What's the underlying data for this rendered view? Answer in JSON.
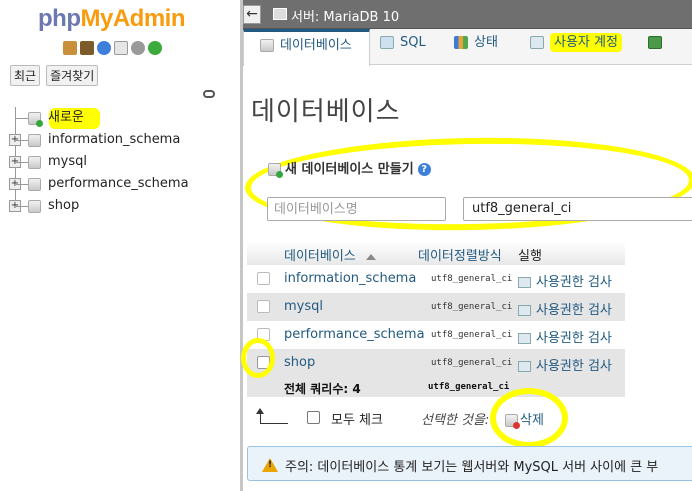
{
  "nav": {
    "logo_part1": "php",
    "logo_part2": "MyAdmin",
    "recent_button": "최근",
    "favorites_button": "즐겨찾기",
    "tree": [
      {
        "label": "새로운"
      },
      {
        "label": "information_schema"
      },
      {
        "label": "mysql"
      },
      {
        "label": "performance_schema"
      },
      {
        "label": "shop"
      }
    ]
  },
  "topbar": {
    "back": "←",
    "server_title": "서버: MariaDB 10"
  },
  "tabs": [
    {
      "label": "데이터베이스",
      "icon": "database-icon",
      "active": true
    },
    {
      "label": "SQL",
      "icon": "sql-icon"
    },
    {
      "label": "상태",
      "icon": "status-chart-icon"
    },
    {
      "label": "사용자 계정",
      "icon": "user-accounts-icon"
    }
  ],
  "page_title": "데이터베이스",
  "create": {
    "title": "새 데이터베이스 만들기",
    "help": "?",
    "name_placeholder": "데이터베이스명",
    "collation": "utf8_general_ci"
  },
  "table": {
    "headers": {
      "database": "데이터베이스",
      "collation": "데이터정렬방식",
      "action": "실행"
    },
    "rows": [
      {
        "name": "information_schema",
        "collation": "utf8_general_ci",
        "action": "사용권한 검사"
      },
      {
        "name": "mysql",
        "collation": "utf8_general_ci",
        "action": "사용권한 검사"
      },
      {
        "name": "performance_schema",
        "collation": "utf8_general_ci",
        "action": "사용권한 검사"
      },
      {
        "name": "shop",
        "collation": "utf8_general_ci",
        "action": "사용권한 검사"
      }
    ],
    "footer": {
      "total": "전체 쿼리수: 4",
      "collation": "utf8_general_ci"
    }
  },
  "bulk": {
    "check_all": "모두 체크",
    "with_selected": "선택한 것을:",
    "delete": "삭제"
  },
  "notice": {
    "text": "주의: 데이터베이스 통계 보기는 웹서버와 MySQL 서버 사이에 큰 부"
  },
  "colors": {
    "accent": "#235a81",
    "highlight": "#ffff00",
    "logo_php": "#6c78af",
    "logo_myadmin": "#f89c0e"
  }
}
